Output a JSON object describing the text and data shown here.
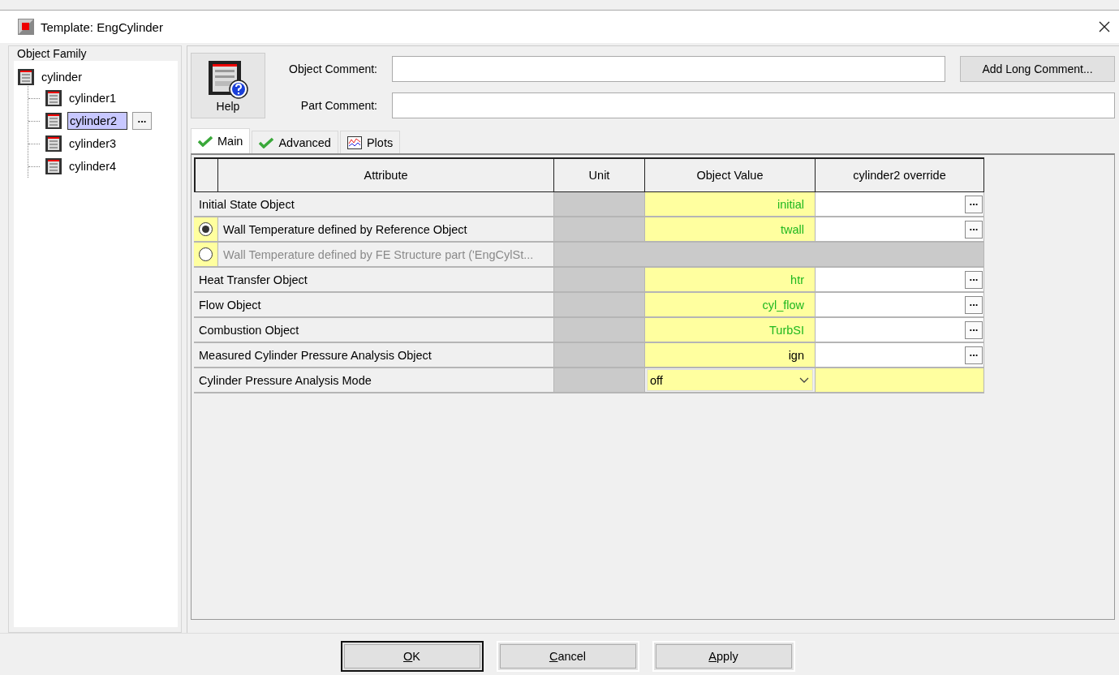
{
  "window": {
    "title": "Template: EngCylinder"
  },
  "object_family": {
    "title": "Object Family",
    "tree": [
      {
        "label": "cylinder",
        "selected": false,
        "children": [
          {
            "label": "cylinder1",
            "selected": false
          },
          {
            "label": "cylinder2",
            "selected": true
          },
          {
            "label": "cylinder3",
            "selected": false
          },
          {
            "label": "cylinder4",
            "selected": false
          }
        ]
      }
    ],
    "edit_button": "..."
  },
  "help_button": "Help",
  "object_comment": {
    "label": "Object Comment:"
  },
  "part_comment": {
    "label": "Part Comment:"
  },
  "add_long_comment_button": "Add Long Comment...",
  "tabs": [
    {
      "label": "Main",
      "kind": "check",
      "selected": true
    },
    {
      "label": "Advanced",
      "kind": "check",
      "selected": false
    },
    {
      "label": "Plots",
      "kind": "plot",
      "selected": false
    }
  ],
  "table": {
    "columns": [
      "Attribute",
      "Unit",
      "Object Value",
      "cylinder2 override"
    ],
    "rows": [
      {
        "kind": "plain",
        "attribute": "Initial State Object",
        "value": "initial",
        "color": "#1fb81f",
        "override_button": "..."
      },
      {
        "kind": "radio",
        "selected": true,
        "disabled": false,
        "attribute": "Wall Temperature defined by Reference Object",
        "value": "twall",
        "color": "#1fb81f",
        "override_button": "..."
      },
      {
        "kind": "radio",
        "selected": false,
        "disabled": true,
        "attribute": "Wall Temperature defined by FE Structure part ('EngCylSt..."
      },
      {
        "kind": "plain",
        "attribute": "Heat Transfer Object",
        "value": "htr",
        "color": "#1fb81f",
        "override_button": "..."
      },
      {
        "kind": "plain",
        "attribute": "Flow Object",
        "value": "cyl_flow",
        "color": "#1fb81f",
        "override_button": "..."
      },
      {
        "kind": "plain",
        "attribute": "Combustion Object",
        "value": "TurbSI",
        "color": "#1fb81f",
        "override_button": "..."
      },
      {
        "kind": "plain",
        "attribute": "Measured Cylinder Pressure Analysis Object",
        "value": "ign",
        "color": "#000000",
        "override_button": "..."
      },
      {
        "kind": "dropdown",
        "attribute": "Cylinder Pressure Analysis Mode",
        "value": "off"
      }
    ]
  },
  "buttons": [
    {
      "label": "OK",
      "default": true,
      "underline_first": true
    },
    {
      "label": "Cancel",
      "default": false,
      "underline_first": true
    },
    {
      "label": "Apply",
      "default": false,
      "underline_first": true
    }
  ]
}
